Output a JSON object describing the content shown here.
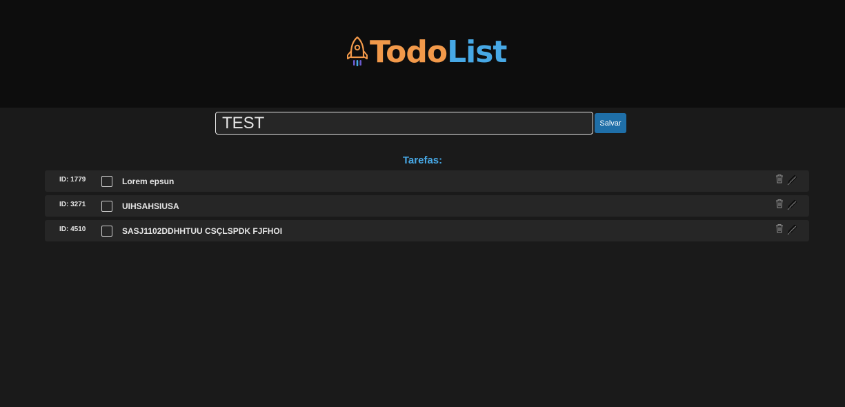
{
  "header": {
    "logo_todo": "Todo",
    "logo_list": "List",
    "logo_icon": "rocket-icon",
    "colors": {
      "todo": "#f2994a",
      "list": "#47a8e5"
    }
  },
  "form": {
    "input_value": "TEST",
    "save_label": "Salvar"
  },
  "tasks": {
    "heading": "Tarefas:",
    "items": [
      {
        "id_label": "ID: 1779",
        "title": "Lorem epsun",
        "done": false
      },
      {
        "id_label": "ID: 3271",
        "title": "UIHSAHSIUSA",
        "done": false
      },
      {
        "id_label": "ID: 4510",
        "title": "SASJ1102DDHHTUU CSÇLSPDK FJFHOI",
        "done": false
      }
    ],
    "actions": {
      "delete_icon": "trash-icon",
      "edit_icon": "pencil-icon"
    }
  },
  "theme": {
    "accent": "#1f6fa8",
    "background": "#1a1a1a",
    "header_bg": "#0d0d0d"
  }
}
